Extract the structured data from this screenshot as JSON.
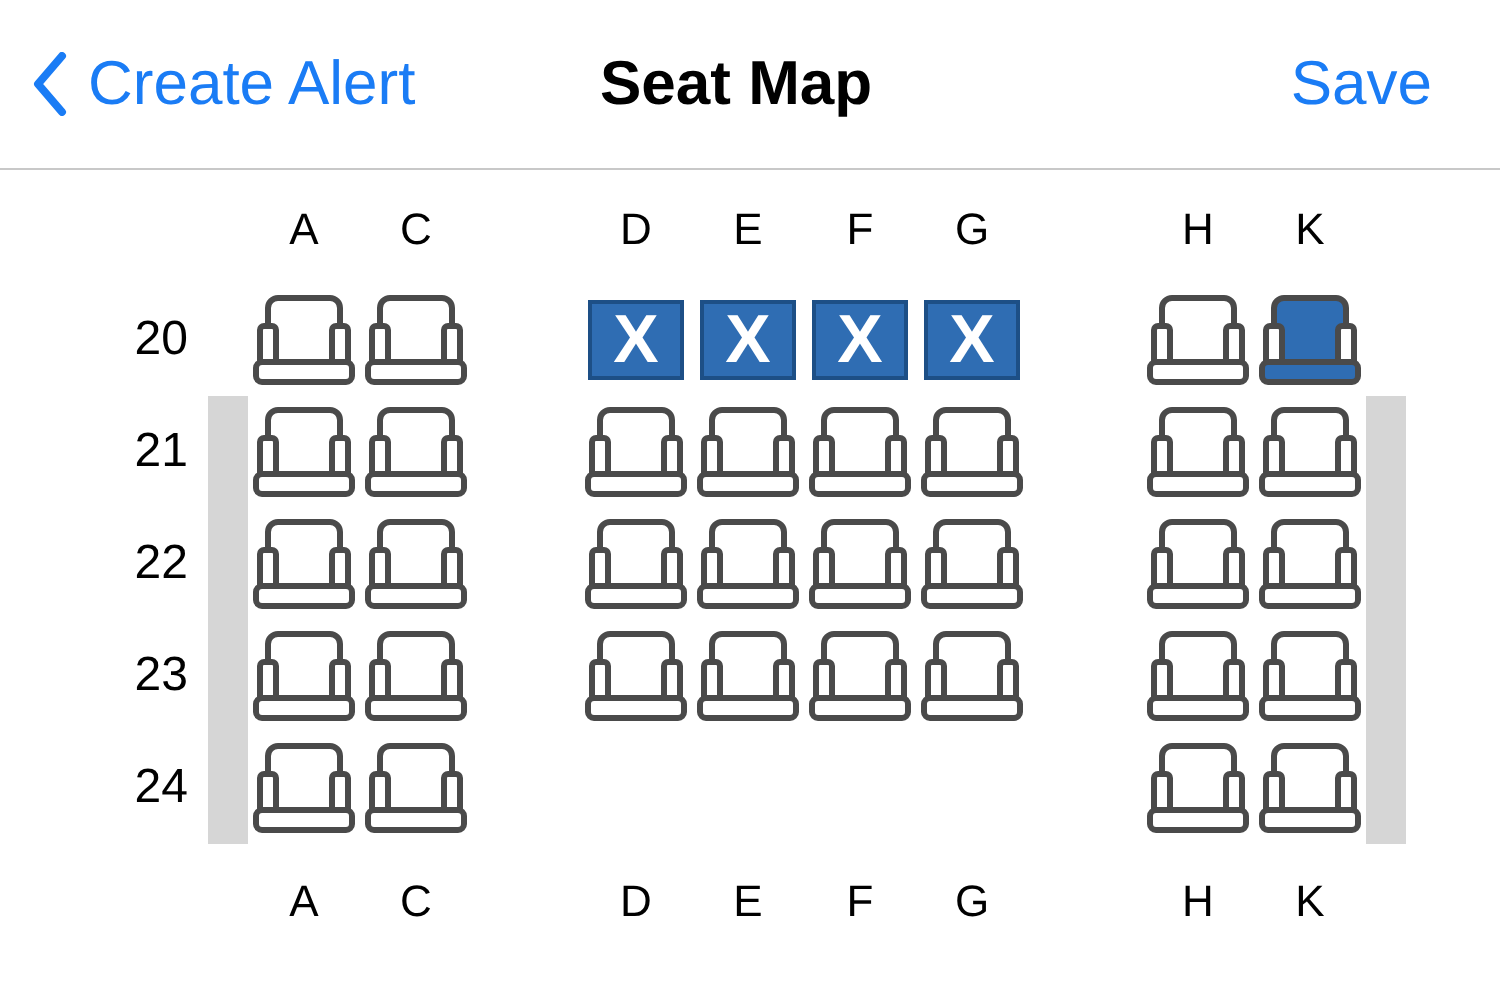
{
  "nav": {
    "back": "Create Alert",
    "title": "Seat Map",
    "action": "Save"
  },
  "columns_top": [
    "A",
    "C",
    "D",
    "E",
    "F",
    "G",
    "H",
    "K"
  ],
  "rows": [
    {
      "label": "20",
      "wall": false,
      "seats": [
        {
          "kind": "open"
        },
        {
          "kind": "open"
        },
        {
          "kind": "occupied",
          "mark": "X"
        },
        {
          "kind": "occupied",
          "mark": "X"
        },
        {
          "kind": "occupied",
          "mark": "X"
        },
        {
          "kind": "occupied",
          "mark": "X"
        },
        {
          "kind": "open"
        },
        {
          "kind": "selected"
        }
      ]
    },
    {
      "label": "21",
      "wall": true,
      "seats": [
        {
          "kind": "open"
        },
        {
          "kind": "open"
        },
        {
          "kind": "open"
        },
        {
          "kind": "open"
        },
        {
          "kind": "open"
        },
        {
          "kind": "open"
        },
        {
          "kind": "open"
        },
        {
          "kind": "open"
        }
      ]
    },
    {
      "label": "22",
      "wall": true,
      "seats": [
        {
          "kind": "open"
        },
        {
          "kind": "open"
        },
        {
          "kind": "open"
        },
        {
          "kind": "open"
        },
        {
          "kind": "open"
        },
        {
          "kind": "open"
        },
        {
          "kind": "open"
        },
        {
          "kind": "open"
        }
      ]
    },
    {
      "label": "23",
      "wall": true,
      "seats": [
        {
          "kind": "open"
        },
        {
          "kind": "open"
        },
        {
          "kind": "open"
        },
        {
          "kind": "open"
        },
        {
          "kind": "open"
        },
        {
          "kind": "open"
        },
        {
          "kind": "open"
        },
        {
          "kind": "open"
        }
      ]
    },
    {
      "label": "24",
      "wall": true,
      "seats": [
        {
          "kind": "open"
        },
        {
          "kind": "open"
        },
        {
          "kind": "none"
        },
        {
          "kind": "none"
        },
        {
          "kind": "none"
        },
        {
          "kind": "none"
        },
        {
          "kind": "open"
        },
        {
          "kind": "open"
        }
      ]
    }
  ],
  "columns_bottom": [
    "A",
    "C",
    "D",
    "E",
    "F",
    "G",
    "H",
    "K"
  ]
}
